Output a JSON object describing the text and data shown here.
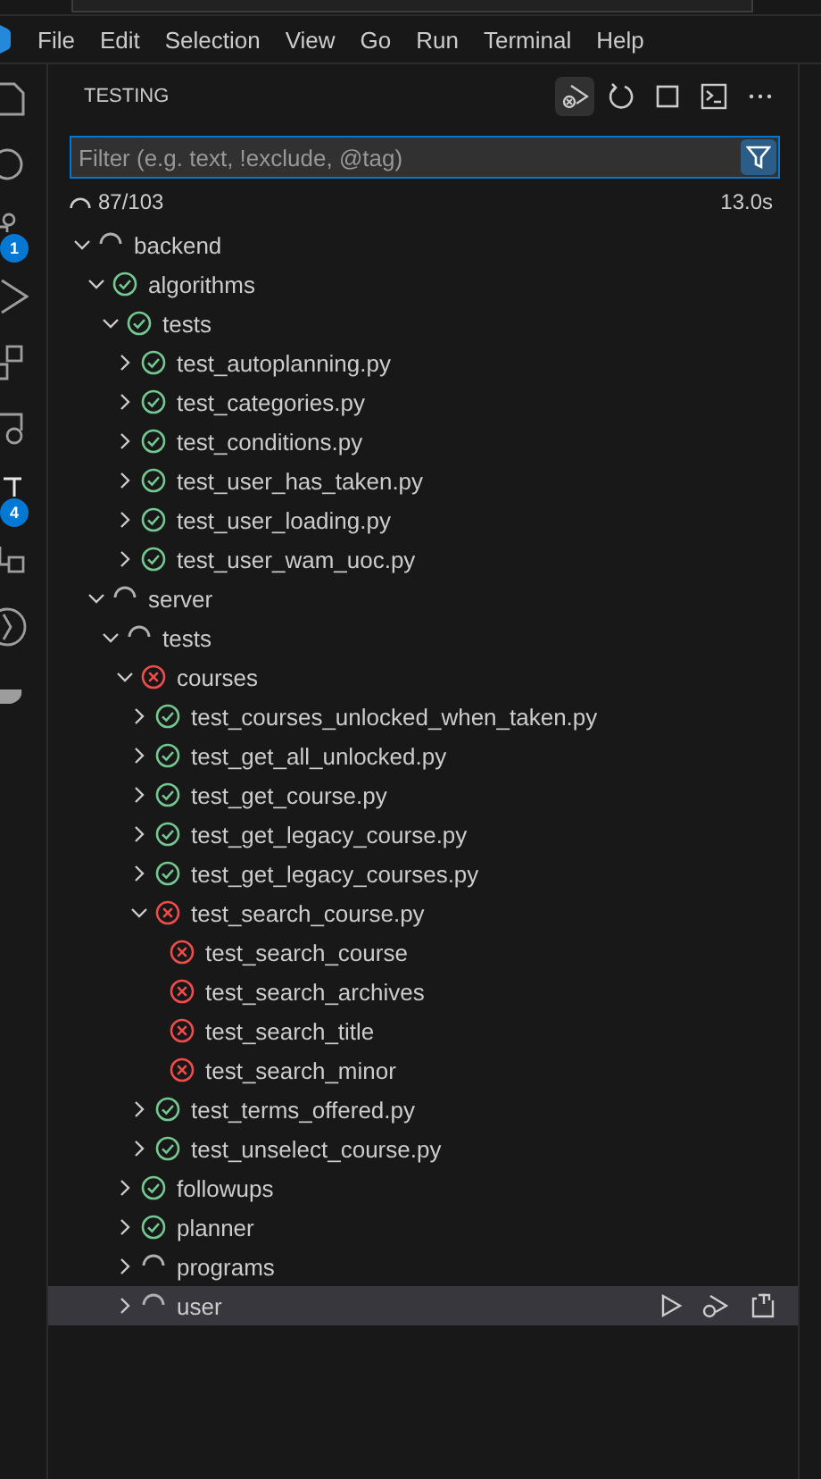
{
  "menu": [
    "File",
    "Edit",
    "Selection",
    "View",
    "Go",
    "Run",
    "Terminal",
    "Help"
  ],
  "activity_bar": {
    "badges": [
      "1",
      "4"
    ]
  },
  "panel": {
    "title": "TESTING",
    "filter": {
      "placeholder": "Filter (e.g. text, !exclude, @tag)"
    },
    "progress": {
      "count": "87/103",
      "time": "13.0s"
    }
  },
  "tree": [
    {
      "label": "backend",
      "kind": "running",
      "expanded": true,
      "selected": false,
      "children": [
        {
          "label": "algorithms",
          "kind": "passed",
          "expanded": true,
          "selected": false,
          "children": [
            {
              "label": "tests",
              "kind": "passed",
              "expanded": true,
              "selected": false,
              "children": [
                {
                  "label": "test_autoplanning.py",
                  "kind": "passed",
                  "expanded": false,
                  "selected": false
                },
                {
                  "label": "test_categories.py",
                  "kind": "passed",
                  "expanded": false,
                  "selected": false
                },
                {
                  "label": "test_conditions.py",
                  "kind": "passed",
                  "expanded": false,
                  "selected": false
                },
                {
                  "label": "test_user_has_taken.py",
                  "kind": "passed",
                  "expanded": false,
                  "selected": false
                },
                {
                  "label": "test_user_loading.py",
                  "kind": "passed",
                  "expanded": false,
                  "selected": false
                },
                {
                  "label": "test_user_wam_uoc.py",
                  "kind": "passed",
                  "expanded": false,
                  "selected": false
                }
              ]
            }
          ]
        },
        {
          "label": "server",
          "kind": "running",
          "expanded": true,
          "selected": false,
          "children": [
            {
              "label": "tests",
              "kind": "running",
              "expanded": true,
              "selected": false,
              "children": [
                {
                  "label": "courses",
                  "kind": "failed",
                  "expanded": true,
                  "selected": false,
                  "children": [
                    {
                      "label": "test_courses_unlocked_when_taken.py",
                      "kind": "passed",
                      "expanded": false,
                      "selected": false
                    },
                    {
                      "label": "test_get_all_unlocked.py",
                      "kind": "passed",
                      "expanded": false,
                      "selected": false
                    },
                    {
                      "label": "test_get_course.py",
                      "kind": "passed",
                      "expanded": false,
                      "selected": false
                    },
                    {
                      "label": "test_get_legacy_course.py",
                      "kind": "passed",
                      "expanded": false,
                      "selected": false
                    },
                    {
                      "label": "test_get_legacy_courses.py",
                      "kind": "passed",
                      "expanded": false,
                      "selected": false
                    },
                    {
                      "label": "test_search_course.py",
                      "kind": "failed",
                      "expanded": true,
                      "selected": false,
                      "children": [
                        {
                          "label": "test_search_course",
                          "kind": "failed",
                          "selected": false
                        },
                        {
                          "label": "test_search_archives",
                          "kind": "failed",
                          "selected": false
                        },
                        {
                          "label": "test_search_title",
                          "kind": "failed",
                          "selected": false
                        },
                        {
                          "label": "test_search_minor",
                          "kind": "failed",
                          "selected": false
                        }
                      ]
                    },
                    {
                      "label": "test_terms_offered.py",
                      "kind": "passed",
                      "expanded": false,
                      "selected": false
                    },
                    {
                      "label": "test_unselect_course.py",
                      "kind": "passed",
                      "expanded": false,
                      "selected": false
                    }
                  ]
                },
                {
                  "label": "followups",
                  "kind": "passed",
                  "expanded": false,
                  "selected": false
                },
                {
                  "label": "planner",
                  "kind": "passed",
                  "expanded": false,
                  "selected": false
                },
                {
                  "label": "programs",
                  "kind": "running",
                  "expanded": false,
                  "selected": false
                },
                {
                  "label": "user",
                  "kind": "running",
                  "expanded": false,
                  "selected": true
                }
              ]
            }
          ]
        }
      ]
    }
  ]
}
